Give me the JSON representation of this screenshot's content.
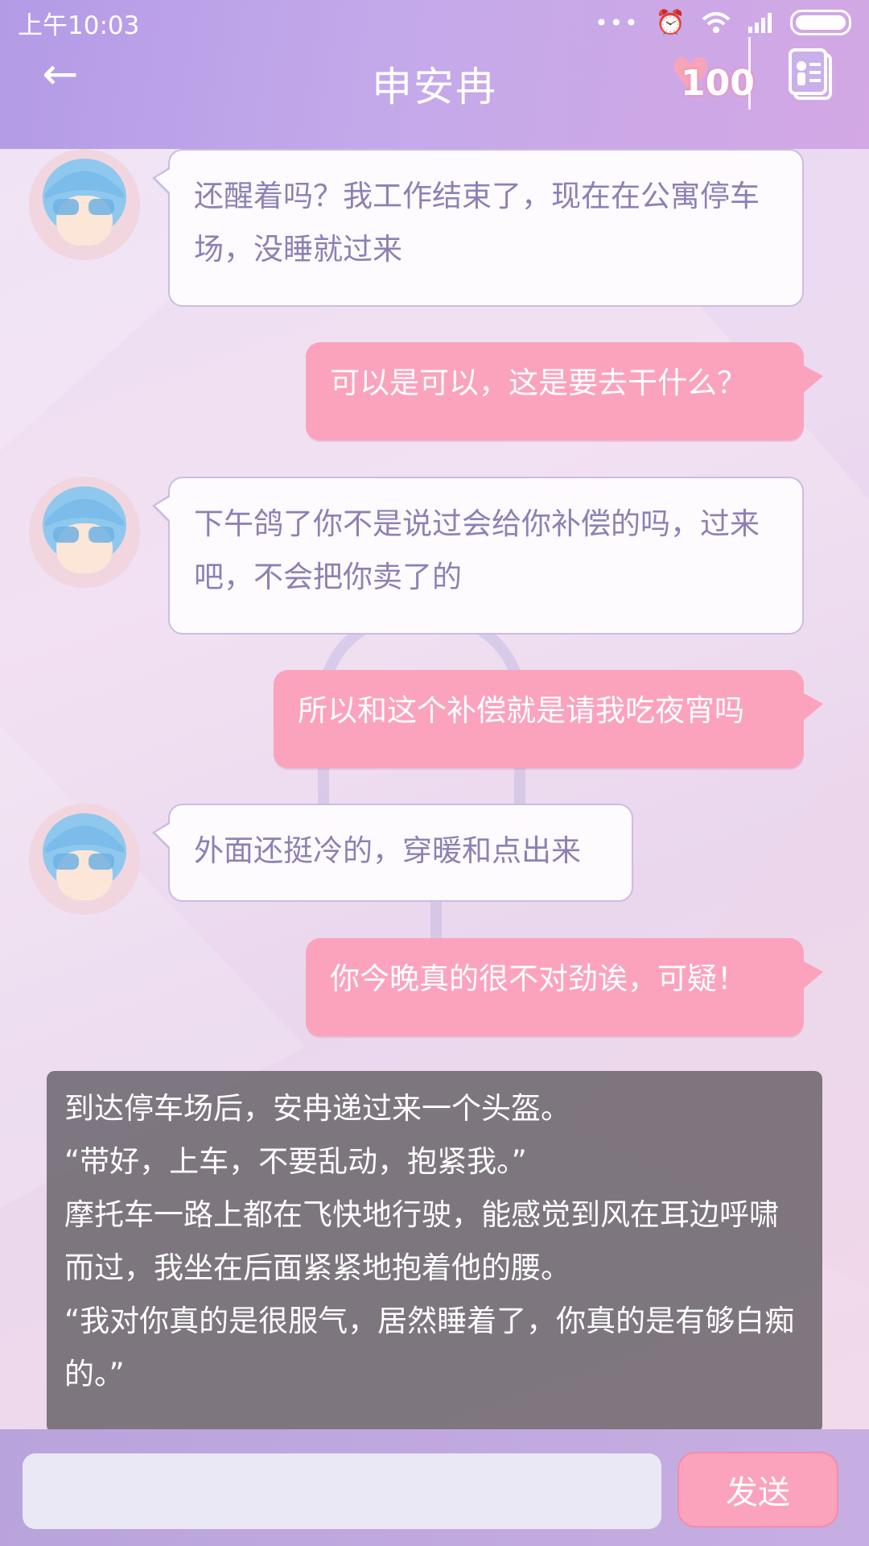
{
  "status_bar": {
    "time": "上午10:03"
  },
  "header": {
    "title": "申安冉",
    "heart_count": "100",
    "back_icon": "back-arrow-icon",
    "contact_icon": "contact-card-icon"
  },
  "messages": [
    {
      "side": "left",
      "text": "还醒着吗？我工作结束了，现在在公寓停车场，没睡就过来"
    },
    {
      "side": "right",
      "text": "可以是可以，这是要去干什么？"
    },
    {
      "side": "left",
      "text": "下午鸽了你不是说过会给你补偿的吗，过来吧，不会把你卖了的"
    },
    {
      "side": "right",
      "text": "所以和这个补偿就是请我吃夜宵吗"
    },
    {
      "side": "left",
      "text": "外面还挺冷的，穿暖和点出来"
    },
    {
      "side": "right",
      "text": "你今晚真的很不对劲诶，可疑！"
    }
  ],
  "narration": {
    "lines": [
      "到达停车场后，安冉递过来一个头盔。",
      "“带好，上车，不要乱动，抱紧我。”",
      "摩托车一路上都在飞快地行驶，能感觉到风在耳边呼啸而过，我坐在后面紧紧地抱着他的腰。",
      "“我对你真的是很服气，居然睡着了，你真的是有够白痴的。”"
    ]
  },
  "input": {
    "value": "",
    "send_label": "发送"
  },
  "colors": {
    "header": "#c4a9ea",
    "bubble_right": "#fba3bc",
    "bubble_left_text": "#8e80b4"
  }
}
